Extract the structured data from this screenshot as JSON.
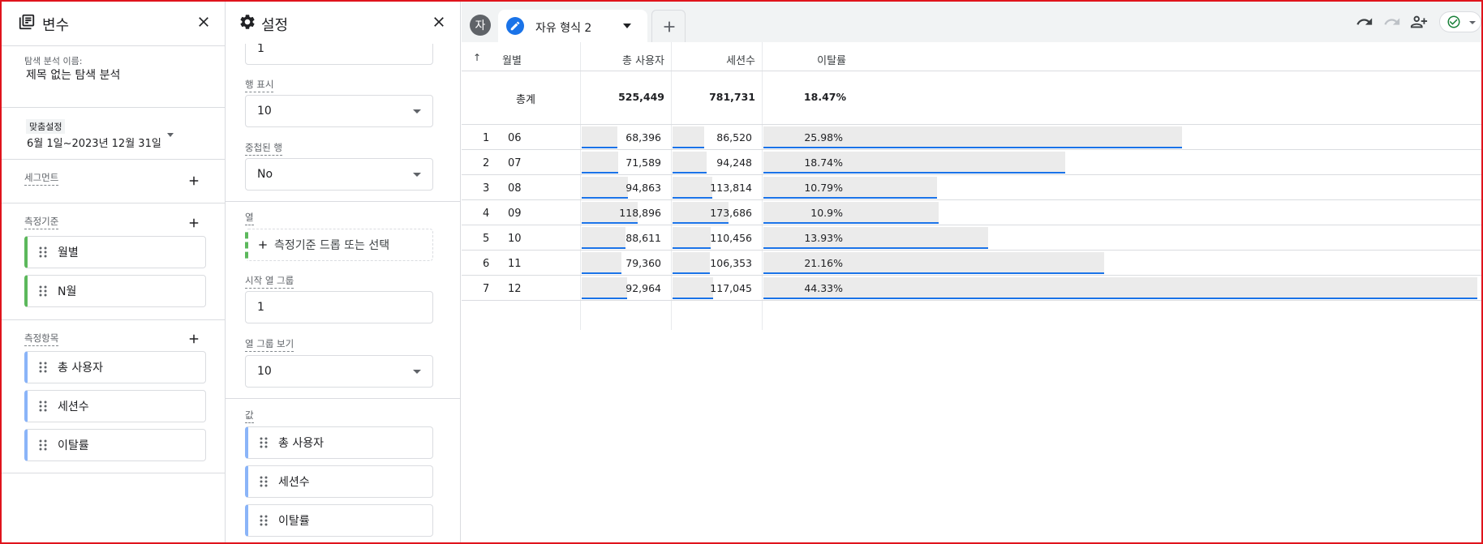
{
  "variables_panel": {
    "title": "변수",
    "exploration_name_label": "탐색 분석 이름:",
    "exploration_name": "제목 없는 탐색 분석",
    "date_badge": "맞춤설정",
    "date_range": "6월 1일~2023년 12월 31일",
    "segments_label": "세그먼트",
    "dimensions_label": "측정기준",
    "dimensions": [
      "월별",
      "N월"
    ],
    "metrics_label": "측정항목",
    "metrics": [
      "총 사용자",
      "세션수",
      "이탈률"
    ]
  },
  "settings_panel": {
    "title": "설정",
    "top_field_value": "1",
    "show_rows_label": "행 표시",
    "show_rows_value": "10",
    "nested_rows_label": "중첩된 행",
    "nested_rows_value": "No",
    "columns_label": "열",
    "columns_drop_text": "측정기준 드롭 또는 선택",
    "start_col_group_label": "시작 열 그룹",
    "start_col_group_value": "1",
    "show_col_groups_label": "열 그룹 보기",
    "show_col_groups_value": "10",
    "values_label": "값",
    "values": [
      "총 사용자",
      "세션수",
      "이탈률"
    ]
  },
  "tabbar": {
    "avatar_letter": "자",
    "tab_label": "자유 형식 2"
  },
  "table": {
    "sort_arrow": "↑",
    "headers": [
      "월별",
      "총 사용자",
      "세션수",
      "이탈률"
    ],
    "total_label": "총계",
    "totals": [
      "525,449",
      "781,731",
      "18.47%"
    ],
    "rows": [
      {
        "idx": "1",
        "month": "06",
        "users": "68,396",
        "sessions": "86,520",
        "bounce": "25.98%"
      },
      {
        "idx": "2",
        "month": "07",
        "users": "71,589",
        "sessions": "94,248",
        "bounce": "18.74%"
      },
      {
        "idx": "3",
        "month": "08",
        "users": "94,863",
        "sessions": "113,814",
        "bounce": "10.79%"
      },
      {
        "idx": "4",
        "month": "09",
        "users": "118,896",
        "sessions": "173,686",
        "bounce": "10.9%"
      },
      {
        "idx": "5",
        "month": "10",
        "users": "88,611",
        "sessions": "110,456",
        "bounce": "13.93%"
      },
      {
        "idx": "6",
        "month": "11",
        "users": "79,360",
        "sessions": "106,353",
        "bounce": "21.16%"
      },
      {
        "idx": "7",
        "month": "12",
        "users": "92,964",
        "sessions": "117,045",
        "bounce": "44.33%"
      }
    ]
  },
  "colors": {
    "accent": "#1a73e8",
    "frame": "#e0141c",
    "dimension_chip": "#5cb85c",
    "metric_chip": "#8ab4f8"
  }
}
